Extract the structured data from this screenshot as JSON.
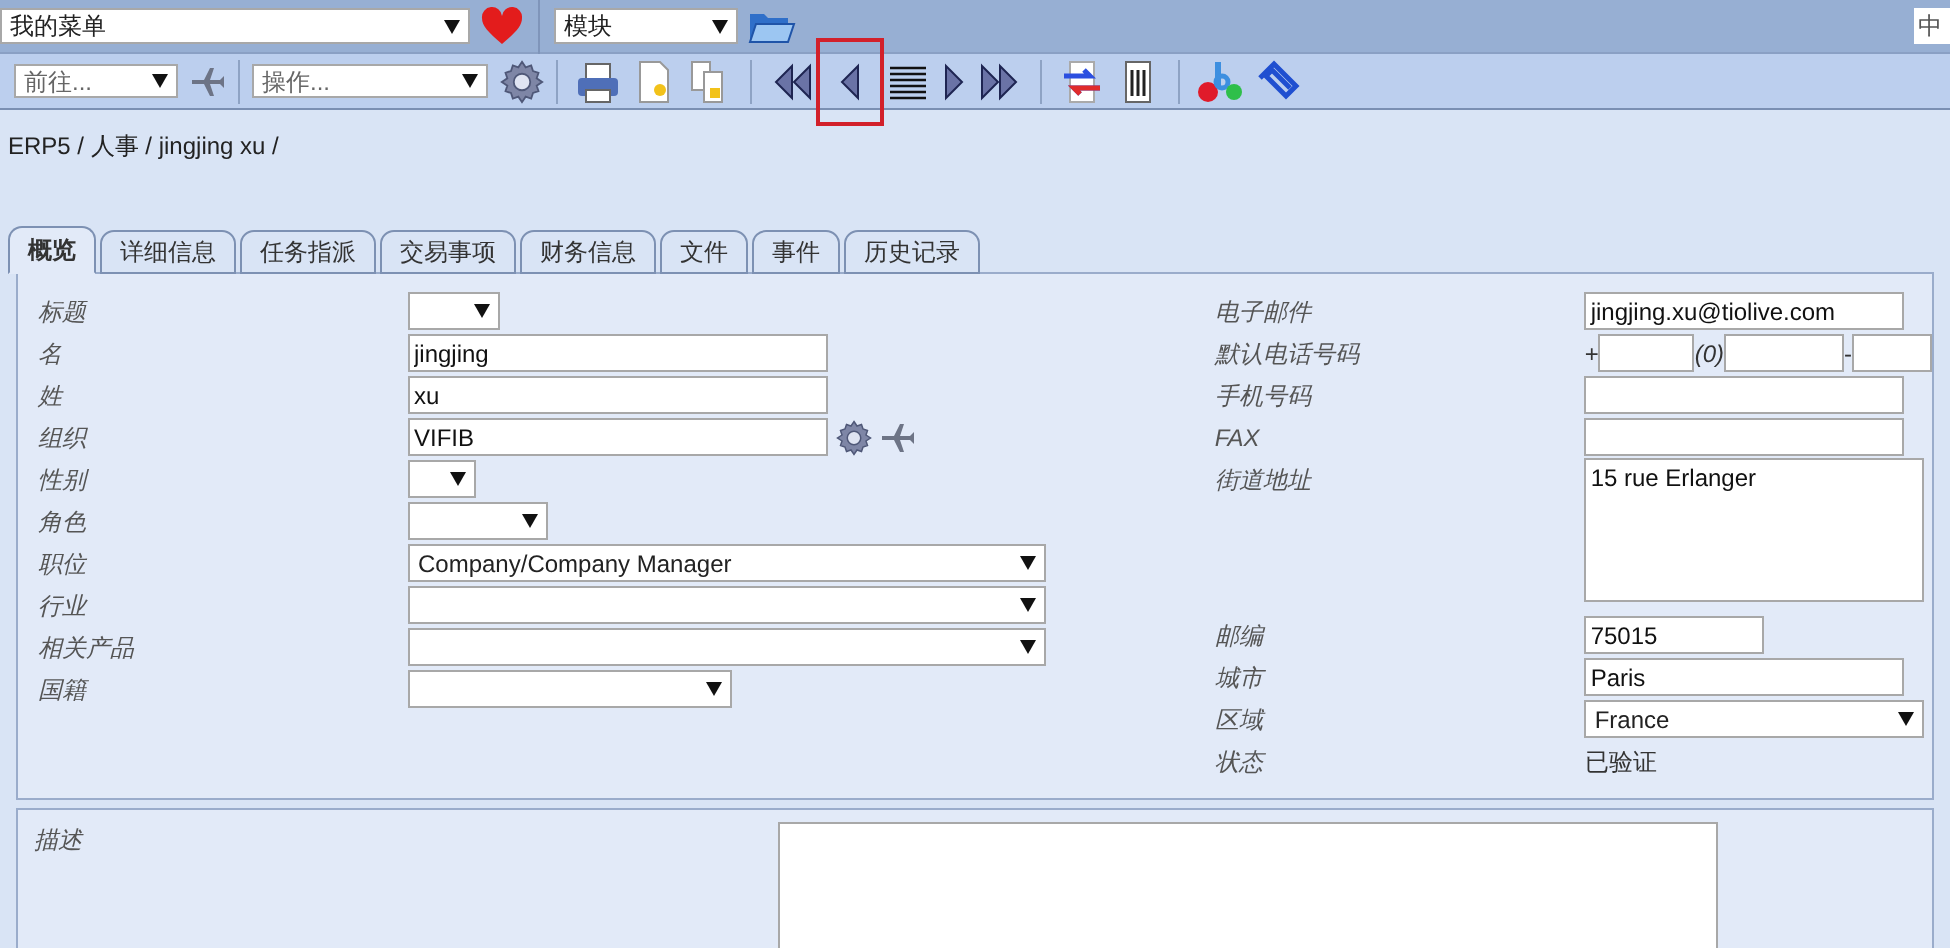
{
  "top_bar": {
    "menu_select": "我的菜单",
    "module_select": "模块",
    "language_field": "中"
  },
  "toolbar": {
    "jump_select": "前往...",
    "action_select": "操作...",
    "previous_highlighted": true
  },
  "breadcrumb": "ERP5 / 人事 / jingjing xu /",
  "tabs": [
    {
      "label": "概览",
      "selected": true
    },
    {
      "label": "详细信息",
      "selected": false
    },
    {
      "label": "任务指派",
      "selected": false
    },
    {
      "label": "交易事项",
      "selected": false
    },
    {
      "label": "财务信息",
      "selected": false
    },
    {
      "label": "文件",
      "selected": false
    },
    {
      "label": "事件",
      "selected": false
    },
    {
      "label": "历史记录",
      "selected": false
    }
  ],
  "left_fields": [
    {
      "label": "标题",
      "kind": "select"
    },
    {
      "label": "名",
      "kind": "text",
      "value": "jingjing"
    },
    {
      "label": "姓",
      "kind": "text",
      "value": "xu"
    },
    {
      "label": "组织",
      "kind": "relation",
      "value": "VIFIB"
    },
    {
      "label": "性别",
      "kind": "select"
    },
    {
      "label": "角色",
      "kind": "select"
    },
    {
      "label": "职位",
      "kind": "select",
      "value": "Company/Company Manager"
    },
    {
      "label": "行业",
      "kind": "select"
    },
    {
      "label": "相关产品",
      "kind": "select"
    },
    {
      "label": "国籍",
      "kind": "select"
    }
  ],
  "right_fields": [
    {
      "label": "电子邮件",
      "kind": "text",
      "value": "jingjing.xu@tiolive.com"
    },
    {
      "label": "默认电话号码",
      "kind": "phone",
      "prefix": "+",
      "area_mark": "(0)",
      "separator": "-"
    },
    {
      "label": "手机号码",
      "kind": "text"
    },
    {
      "label": "FAX",
      "kind": "text"
    },
    {
      "label": "街道地址",
      "kind": "textarea",
      "value": "15 rue Erlanger"
    },
    {
      "label": "邮编",
      "kind": "text",
      "value": "75015"
    },
    {
      "label": "城市",
      "kind": "text",
      "value": "Paris"
    },
    {
      "label": "区域",
      "kind": "select",
      "value": "France"
    },
    {
      "label": "状态",
      "kind": "static",
      "value": "已验证"
    }
  ],
  "description": {
    "label": "描述"
  }
}
